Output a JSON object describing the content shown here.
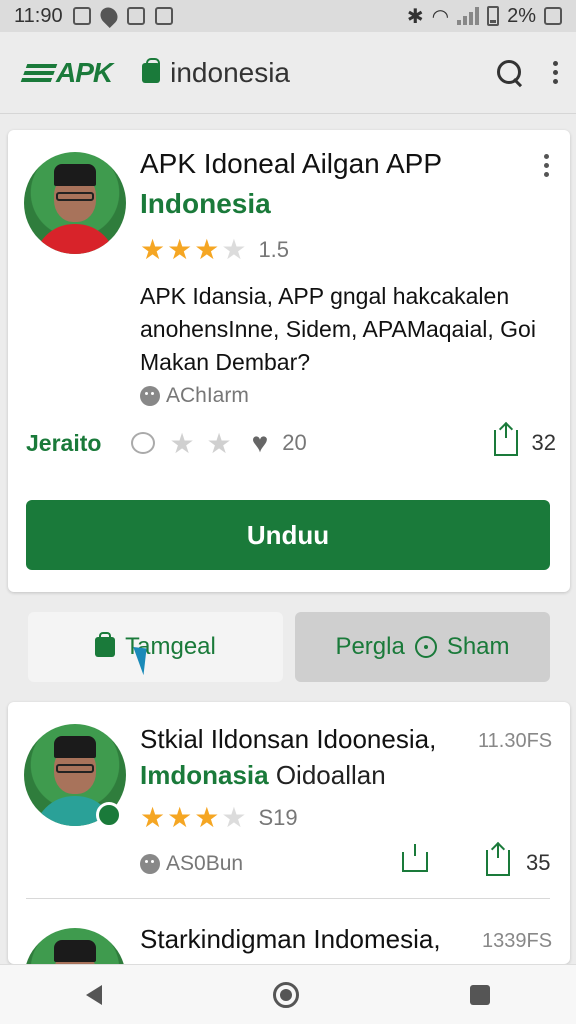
{
  "status_bar": {
    "time": "11:90",
    "battery": "2%"
  },
  "app_bar": {
    "logo": "APK",
    "search_text": "indonesia"
  },
  "featured": {
    "title": "APK Idoneal Ailgan APP",
    "subtitle": "Indonesia",
    "rating": "1.5",
    "rating_stars": 3,
    "description": "APK Idansia, APP gngal hakcakalen anohensInne, Sidem, APAMaqaial, Goi Makan Dembar?",
    "author": "AChIarm",
    "category": "Jeraito",
    "likes": "20",
    "downloads": "32",
    "download_button": "Unduu"
  },
  "tabs": {
    "tab1": "Tamgeal",
    "tab2_left": "Pergla",
    "tab2_right": "Sham"
  },
  "list_items": [
    {
      "title": "Stkial Ildonsan Idoonesia,",
      "subtitle_green": "Imdonasia",
      "subtitle_rest": "Oidoallan",
      "time": "11.30FS",
      "rating": "S19",
      "author": "AS0Bun",
      "downloads": "35"
    },
    {
      "title": "Starkindigman Indomesia,",
      "time": "1339FS"
    }
  ],
  "colors": {
    "brand_green": "#1a7a3a",
    "star_gold": "#f5a623"
  }
}
